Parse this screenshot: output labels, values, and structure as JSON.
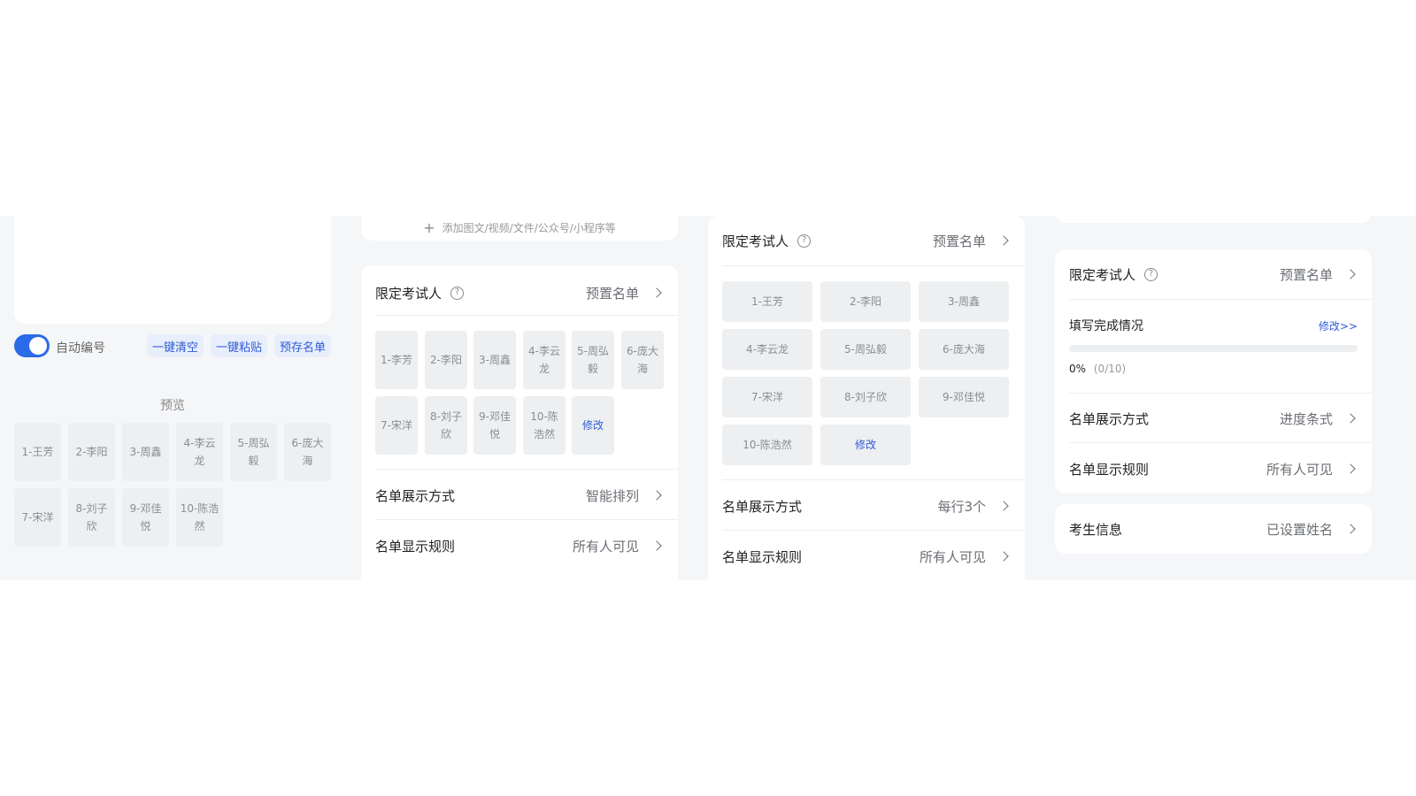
{
  "panel1": {
    "auto_number_label": "自动编号",
    "auto_number_on": true,
    "buttons": [
      "一键清空",
      "一键粘贴",
      "预存名单"
    ],
    "preview_label": "预览",
    "names": [
      "1-王芳",
      "2-李阳",
      "3-周鑫",
      "4-李云龙",
      "5-周弘毅",
      "6-庞大海",
      "7-宋洋",
      "8-刘子欣",
      "9-邓佳悦",
      "10-陈浩然"
    ]
  },
  "panel2": {
    "add_hint": "添加图文/视频/文件/公众号/小程序等",
    "limit_label": "限定考试人",
    "limit_value": "预置名单",
    "names": [
      "1-李芳",
      "2-李阳",
      "3-周鑫",
      "4-李云龙",
      "5-周弘毅",
      "6-庞大海",
      "7-宋洋",
      "8-刘子欣",
      "9-邓佳悦",
      "10-陈浩然"
    ],
    "edit_label": "修改",
    "display_mode_label": "名单展示方式",
    "display_mode_value": "智能排列",
    "display_rule_label": "名单显示规则",
    "display_rule_value": "所有人可见"
  },
  "panel3": {
    "limit_label": "限定考试人",
    "limit_value": "预置名单",
    "names": [
      "1-王芳",
      "2-李阳",
      "3-周鑫",
      "4-李云龙",
      "5-周弘毅",
      "6-庞大海",
      "7-宋洋",
      "8-刘子欣",
      "9-邓佳悦",
      "10-陈浩然"
    ],
    "edit_label": "修改",
    "display_mode_label": "名单展示方式",
    "display_mode_value": "每行3个",
    "display_rule_label": "名单显示规则",
    "display_rule_value": "所有人可见"
  },
  "panel4": {
    "limit_label": "限定考试人",
    "limit_value": "预置名单",
    "completion_label": "填写完成情况",
    "completion_edit": "修改>>",
    "progress_percent": "0%",
    "progress_count": "(0/10)",
    "progress_fraction": 0,
    "display_mode_label": "名单展示方式",
    "display_mode_value": "进度条式",
    "display_rule_label": "名单显示规则",
    "display_rule_value": "所有人可见",
    "examinee_label": "考生信息",
    "examinee_value": "已设置姓名"
  },
  "colors": {
    "accent": "#2b6ae8",
    "chip_bg": "#eeeff1",
    "panel_bg": "#f5f6f8",
    "link": "#2f5bd6"
  },
  "icons": {
    "help": "question-circle-icon",
    "chevron": "chevron-right-icon",
    "plus": "plus-icon"
  }
}
